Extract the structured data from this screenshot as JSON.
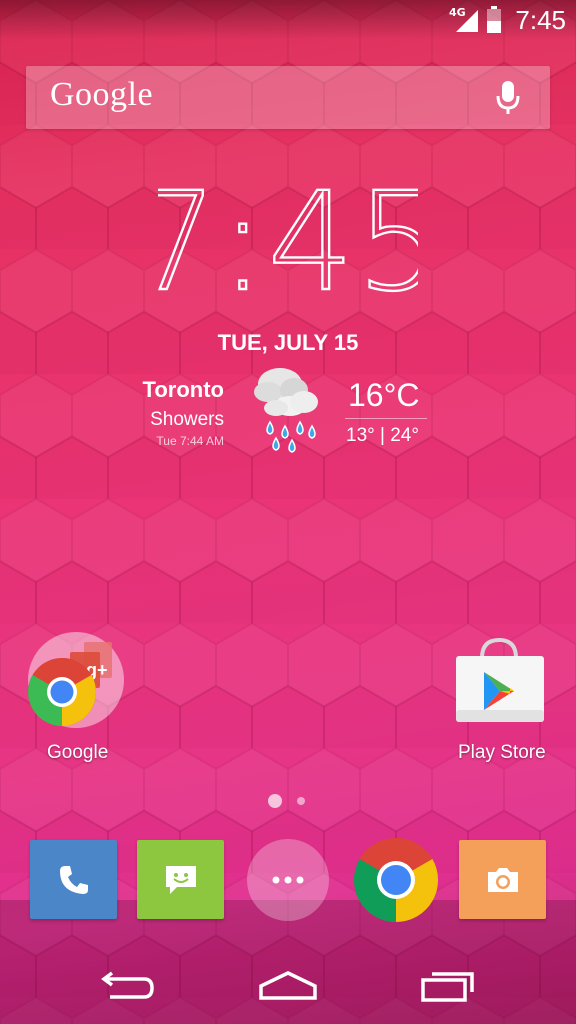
{
  "status_bar": {
    "network": "4G",
    "time": "7:45"
  },
  "search": {
    "logo": "Google",
    "mic_icon": "microphone-icon"
  },
  "clock": {
    "time": "7:45",
    "date": "TUE, JULY 15"
  },
  "weather": {
    "city": "Toronto",
    "condition": "Showers",
    "updated": "Tue 7:44 AM",
    "temperature": "16°C",
    "range": "13° | 24°",
    "icon": "rain-showers-icon"
  },
  "desktop": {
    "apps": [
      {
        "label": "Google",
        "icon": "google-folder-icon"
      },
      {
        "label": "Play Store",
        "icon": "play-store-icon"
      }
    ]
  },
  "pager": {
    "pages": 2,
    "current": 1
  },
  "dock": {
    "items": [
      {
        "name": "phone",
        "icon": "phone-icon",
        "color": "#4a86c8"
      },
      {
        "name": "messaging",
        "icon": "message-icon",
        "color": "#8dc63f"
      },
      {
        "name": "all-apps",
        "icon": "apps-launcher-icon"
      },
      {
        "name": "chrome",
        "icon": "chrome-icon"
      },
      {
        "name": "camera",
        "icon": "camera-icon",
        "color": "#f5a05a"
      }
    ]
  },
  "navigation": {
    "back": "back-icon",
    "home": "home-icon",
    "recents": "recents-icon"
  }
}
